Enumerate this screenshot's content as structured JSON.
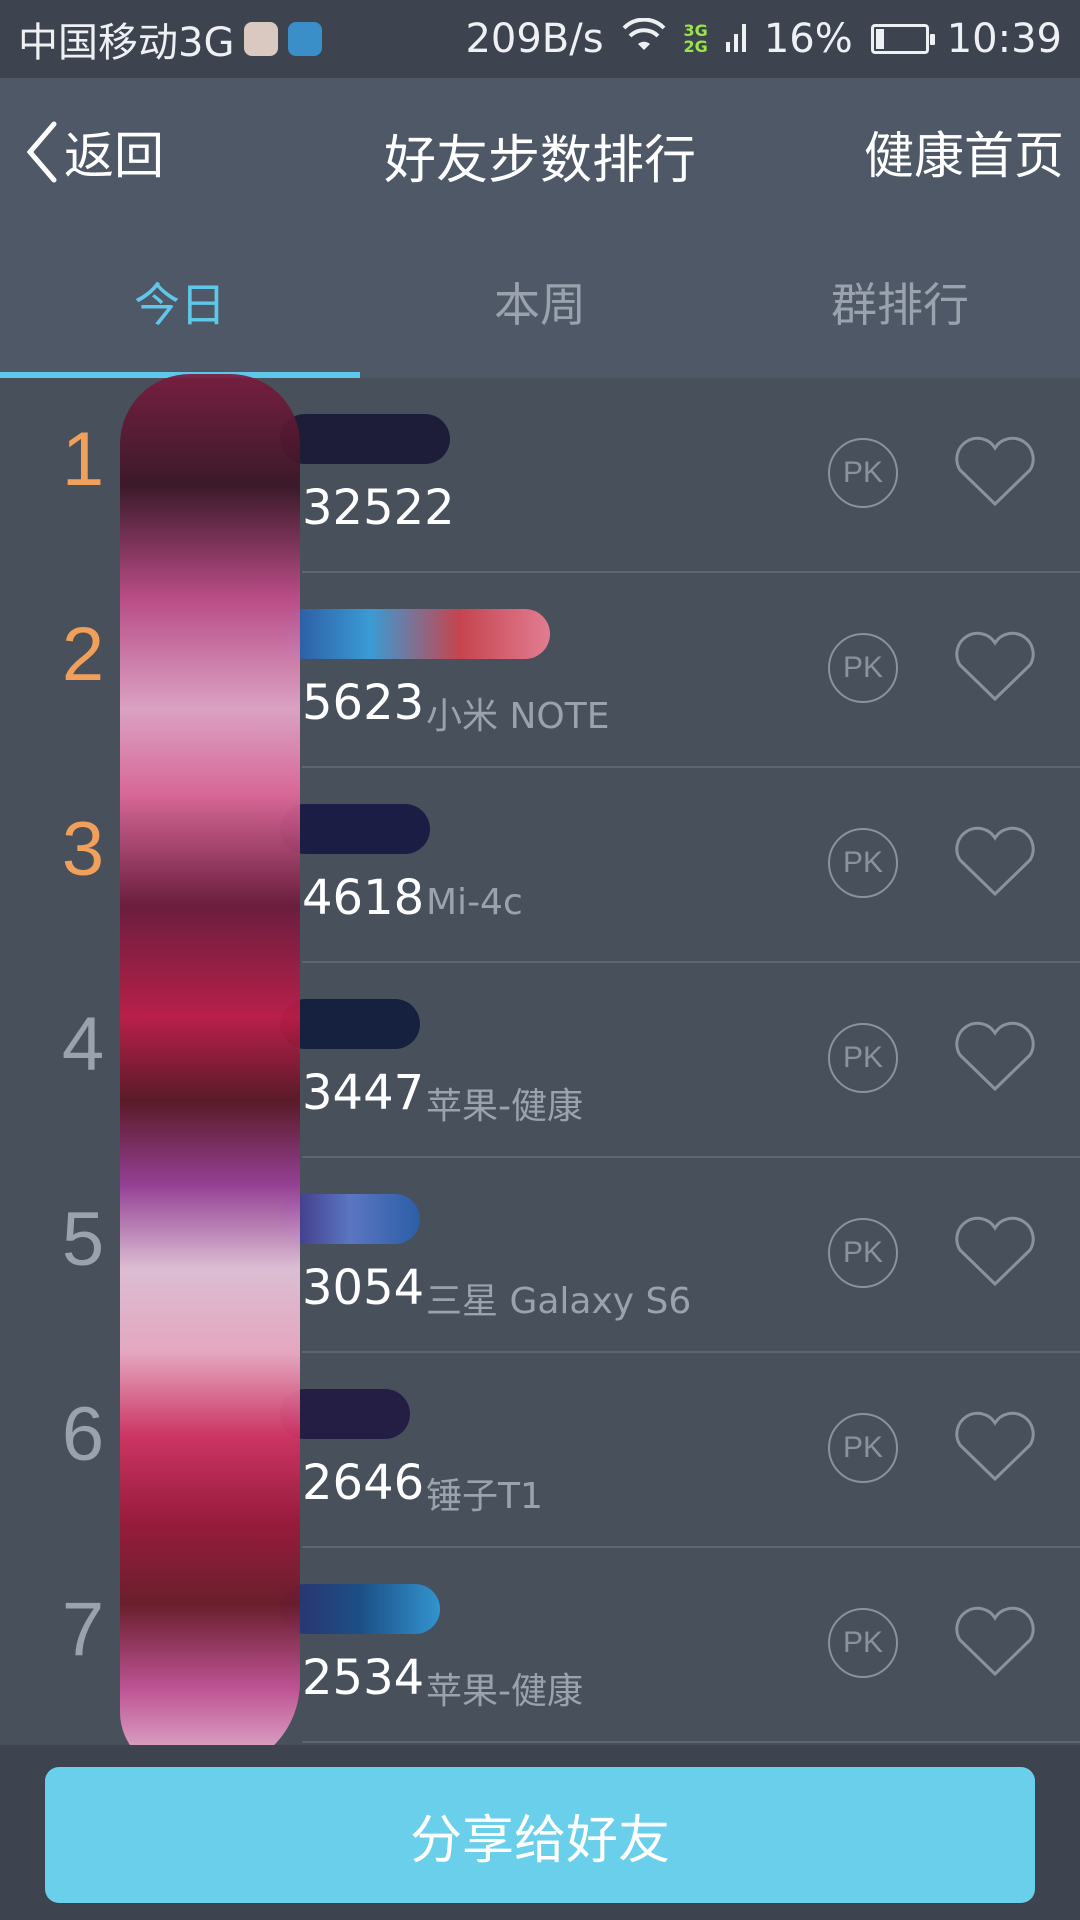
{
  "status_bar": {
    "carrier": "中国移动3G",
    "speed": "209B/s",
    "net_3g": "3G",
    "net_2g": "2G",
    "battery": "16%",
    "time": "10:39"
  },
  "header": {
    "back_label": "返回",
    "title": "好友步数排行",
    "home_label": "健康首页"
  },
  "tabs": [
    {
      "label": "今日",
      "active": true
    },
    {
      "label": "本周",
      "active": false
    },
    {
      "label": "群排行",
      "active": false
    }
  ],
  "rows": [
    {
      "rank": "1",
      "steps": "32522",
      "device": ""
    },
    {
      "rank": "2",
      "steps": "5623",
      "device": "小米 NOTE"
    },
    {
      "rank": "3",
      "steps": "4618",
      "device": "Mi-4c"
    },
    {
      "rank": "4",
      "steps": "3447",
      "device": "苹果-健康"
    },
    {
      "rank": "5",
      "steps": "3054",
      "device": "三星 Galaxy S6"
    },
    {
      "rank": "6",
      "steps": "2646",
      "device": "锤子T1"
    },
    {
      "rank": "7",
      "steps": "2534",
      "device": "苹果-健康"
    }
  ],
  "pk_label": "PK",
  "share_button": "分享给好友",
  "colors": {
    "accent": "#5fc8ea",
    "top_rank": "#f0a05a",
    "button": "#6acfeb"
  }
}
